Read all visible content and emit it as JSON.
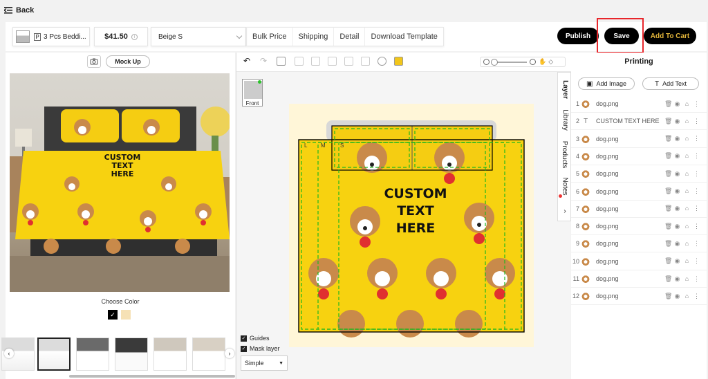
{
  "back": {
    "label": "Back"
  },
  "toolbar": {
    "product_name": "3 Pcs Beddi...",
    "product_badge": "P",
    "price": "$41.50",
    "variant": "Beige S",
    "tabs": [
      "Bulk Price",
      "Shipping",
      "Detail",
      "Download Template"
    ],
    "publish_label": "Publish",
    "save_label": "Save",
    "cart_label": "Add To Cart",
    "cart_color": "#e0b33a"
  },
  "left": {
    "mockup_label": "Mock Up",
    "choose_color_label": "Choose Color",
    "swatch_check": "✓",
    "mockup_text": [
      "CUSTOM",
      "TEXT",
      "HERE"
    ]
  },
  "canvas": {
    "front_label": "Front",
    "size_markers": [
      "L",
      "M",
      "S"
    ],
    "design_text": [
      "CUSTOM",
      "TEXT",
      "HERE"
    ],
    "design_color": "#f7d210",
    "guides_label": "Guides",
    "mask_label": "Mask layer",
    "mode_select": "Simple"
  },
  "vtabs": [
    "Layer",
    "Library",
    "Products",
    "Notes"
  ],
  "right": {
    "title": "Printing",
    "add_image_label": "Add Image",
    "add_text_label": "Add Text",
    "layers": [
      {
        "num": "1",
        "name": "dog.png",
        "type": "image"
      },
      {
        "num": "2",
        "name": "CUSTOM TEXT HERE",
        "type": "text"
      },
      {
        "num": "3",
        "name": "dog.png",
        "type": "image"
      },
      {
        "num": "4",
        "name": "dog.png",
        "type": "image"
      },
      {
        "num": "5",
        "name": "dog.png",
        "type": "image"
      },
      {
        "num": "6",
        "name": "dog.png",
        "type": "image"
      },
      {
        "num": "7",
        "name": "dog.png",
        "type": "image"
      },
      {
        "num": "8",
        "name": "dog.png",
        "type": "image"
      },
      {
        "num": "9",
        "name": "dog.png",
        "type": "image"
      },
      {
        "num": "10",
        "name": "dog.png",
        "type": "image"
      },
      {
        "num": "11",
        "name": "dog.png",
        "type": "image"
      },
      {
        "num": "12",
        "name": "dog.png",
        "type": "image"
      }
    ]
  }
}
